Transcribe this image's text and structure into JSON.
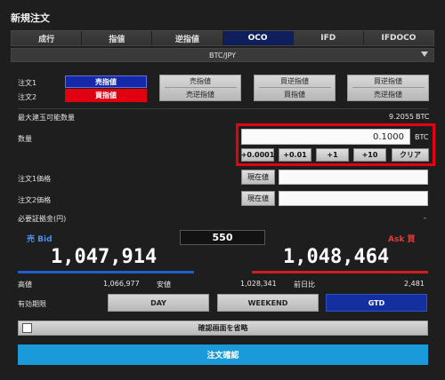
{
  "header": {
    "title": "新規注文"
  },
  "tabs": [
    "成行",
    "指値",
    "逆指値",
    "OCO",
    "IFD",
    "IFDOCO"
  ],
  "pair": "BTC/JPY",
  "order_rows": {
    "order1_label": "注文1",
    "order2_label": "注文2"
  },
  "side": {
    "sell": "売指値",
    "buy": "買指値"
  },
  "order_types": [
    {
      "top": "売指値",
      "bottom": "売逆指値"
    },
    {
      "top": "買逆指値",
      "bottom": "買指値"
    },
    {
      "top": "買逆指値",
      "bottom": "売逆指値"
    }
  ],
  "max_qty": {
    "label": "最大建玉可能数量",
    "value": "9.2055",
    "unit": "BTC"
  },
  "quantity": {
    "label": "数量",
    "value": "0.1000",
    "unit": "BTC",
    "steps": [
      "+0.0001",
      "+0.01",
      "+1",
      "+10"
    ],
    "clear": "クリア"
  },
  "price1": {
    "label": "注文1価格",
    "button": "現在値"
  },
  "price2": {
    "label": "注文2価格",
    "button": "現在値"
  },
  "margin": {
    "label": "必要証拠金(円)",
    "value": "-"
  },
  "quote": {
    "bid_label": "売 Bid",
    "ask_label": "Ask 買",
    "spread": "550",
    "bid": "1,047,914",
    "ask": "1,048,464"
  },
  "stats": {
    "high_label": "高値",
    "high": "1,066,977",
    "low_label": "安値",
    "low": "1,028,341",
    "change_label": "前日比",
    "change": "2,481"
  },
  "expiry": {
    "label": "有効期限",
    "options": [
      "DAY",
      "WEEKEND",
      "GTD"
    ],
    "selected": "GTD"
  },
  "skip_confirm": "確認画面を省略",
  "confirm_button": "注文確認",
  "colors": {
    "accent_blue": "#1428a8",
    "accent_red": "#e00010",
    "highlight": "#e50012",
    "confirm": "#1a9ad8"
  }
}
